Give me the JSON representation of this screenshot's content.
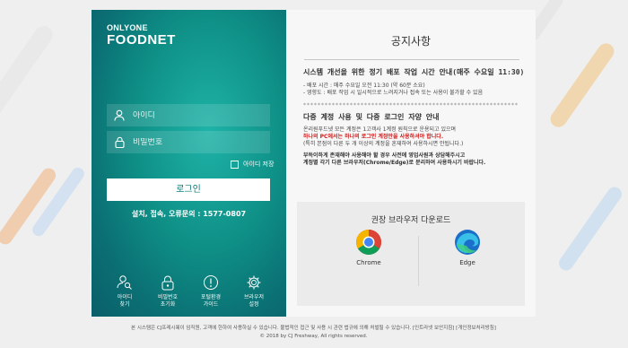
{
  "login": {
    "logo_small": "ONLYONE",
    "logo_big": "FOODNET",
    "id_placeholder": "아이디",
    "pw_placeholder": "비밀번호",
    "remember_label": "아이디 저장",
    "login_button": "로그인",
    "error_contact": "설치, 접속, 오류문의 : 1577-0807"
  },
  "quick_links": [
    {
      "label": "아이디\n찾기",
      "icon": "person-search-icon"
    },
    {
      "label": "비밀번호\n초기화",
      "icon": "lock-icon"
    },
    {
      "label": "포털환경\n가이드",
      "icon": "alert-icon"
    },
    {
      "label": "브라우저\n설정",
      "icon": "gear-icon"
    }
  ],
  "notice": {
    "title": "공지사항",
    "section1_heading": "시스템 개선을 위한 정기 배포 작업 시간 안내(매주 수요일 11:30)",
    "section1_line1": "- 배포 시간 : 매주 수요일 오전 11:30 (약 60분 소요)",
    "section1_line2": "- 영향도 : 배포 작업 시 일시적으로 느려지거나 접속 또는 사용이 불가할 수 있음",
    "separator": "************************************************************",
    "section2_heading": "다중 계정 사용 및 다중 로그인 자양 안내",
    "section2_line1": "온리원푸드넷 모든 계정은 1고객사 1계정 원칙으로 운용되고 있으며",
    "section2_line2_red": "하나의 PC에서는 하나의 로그인 계정만을 사용하셔야 합니다.",
    "section2_line3": "(특히 본점이 다른 두 개 이상의 계정을 혼재하여 사용하시면 안됩니다.)",
    "section2_line4": "부득이하게 존재해야 사용해야 할 경우 사전에 영업사원과 상담해주시고",
    "section2_line5": "계정별 각기 다른 브라우저(Chrome/Edge)로 분리하여 사용하시기 바랍니다."
  },
  "browsers": {
    "title": "권장 브라우저 다운로드",
    "chrome": "Chrome",
    "edge": "Edge"
  },
  "footer": {
    "line1": "본 시스템은 CJ프레시웨이 임직원, 고객에 한하여 사용하실 수 있습니다. 불법적인 접근 및 사용 시 관련 법규에 의해 처벌될 수 있습니다.  [인트라넷 보안지침] [개인정보처리방침]",
    "line2": "© 2018 by CJ Freshway, All rights reserved."
  }
}
